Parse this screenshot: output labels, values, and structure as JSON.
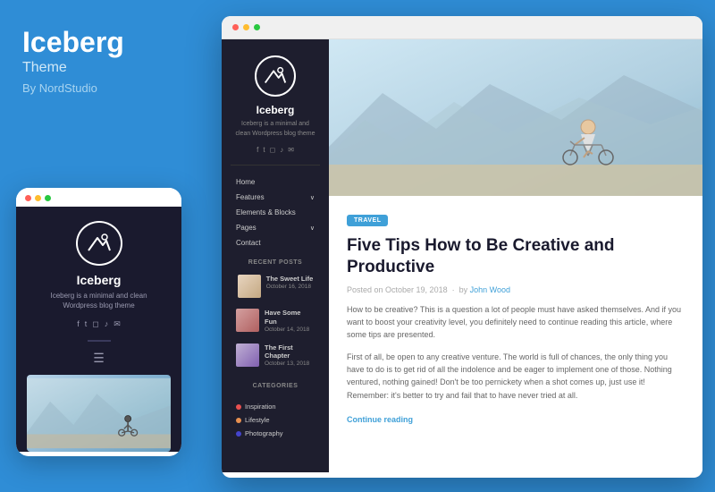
{
  "left": {
    "brand": "Iceberg",
    "subtitle": "Theme",
    "by": "By NordStudio"
  },
  "mobile": {
    "brand": "Iceberg",
    "tagline": "Iceberg is a minimal and clean\nWordpress blog theme",
    "social_icons": [
      "f",
      "t",
      "i",
      "d",
      "w"
    ]
  },
  "browser": {
    "sidebar": {
      "brand": "Iceberg",
      "tagline": "Iceberg is a minimal and\nclean Wordpress blog theme",
      "nav": [
        {
          "label": "Home",
          "has_arrow": false
        },
        {
          "label": "Features",
          "has_arrow": true
        },
        {
          "label": "Elements & Blocks",
          "has_arrow": false
        },
        {
          "label": "Pages",
          "has_arrow": true
        },
        {
          "label": "Contact",
          "has_arrow": false
        }
      ],
      "recent_posts_title": "RECENT POSTS",
      "recent_posts": [
        {
          "title": "The Sweet Life",
          "date": "October 16, 2018"
        },
        {
          "title": "Have Some Fun",
          "date": "October 14, 2018"
        },
        {
          "title": "The First Chapter",
          "date": "October 13, 2018"
        }
      ],
      "categories_title": "CATEGORIES",
      "categories": [
        {
          "label": "Inspiration",
          "color": "#e85050"
        },
        {
          "label": "Lifestyle",
          "color": "#e89050"
        },
        {
          "label": "Photography",
          "color": "#4444cc"
        }
      ]
    },
    "article": {
      "badge": "TRAVEL",
      "title": "Five Tips How to Be Creative and Productive",
      "meta": "Posted on October 19, 2018 · by John Wood",
      "body_1": "How to be creative? This is a question a lot of people must have asked themselves. And if you want to boost your creativity level, you definitely need to continue reading this article, where some tips are presented.",
      "body_2": "First of all, be open to any creative venture. The world is full of chances, the only thing you have to do is to get rid of all the indolence and be eager to implement one of those. Nothing ventured, nothing gained! Don't be too pernickety when a shot comes up, just use it! Remember: it's better to try and fail that to have never tried at all.",
      "continue": "Continue reading"
    }
  }
}
